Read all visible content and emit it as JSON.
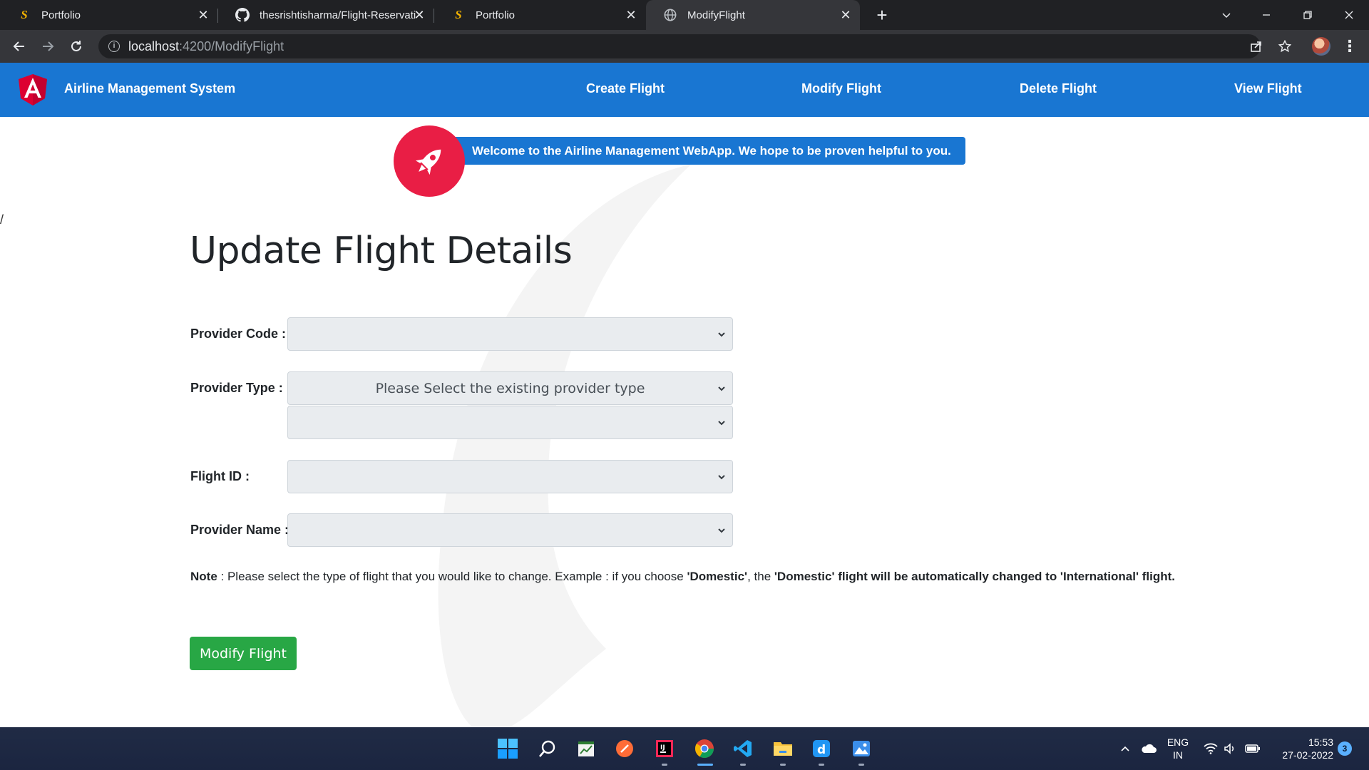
{
  "browser": {
    "tabs": [
      {
        "title": "Portfolio",
        "icon": "portfolio-s-icon"
      },
      {
        "title": "thesrishtisharma/Flight-Reservati",
        "icon": "github-icon"
      },
      {
        "title": "Portfolio",
        "icon": "portfolio-s-icon"
      },
      {
        "title": "ModifyFlight",
        "icon": "globe-icon"
      }
    ],
    "active_tab_index": 3,
    "url_host": "localhost",
    "url_path": ":4200/ModifyFlight"
  },
  "navbar": {
    "brand": "Airline Management System",
    "links": [
      "Create Flight",
      "Modify Flight",
      "Delete Flight",
      "View Flight"
    ]
  },
  "welcome": {
    "message": "Welcome to the Airline Management WebApp. We hope to be proven helpful to you."
  },
  "stray_text": "/",
  "form": {
    "title": "Update Flight Details",
    "provider_code_label": "Provider Code :",
    "provider_code_value": "",
    "provider_type_label": "Provider Type :",
    "provider_type_placeholder": "Please Select the existing provider type",
    "provider_type_secondary_value": "",
    "flight_id_label": "Flight ID :",
    "flight_id_value": "",
    "provider_name_label": "Provider Name :",
    "provider_name_value": "",
    "note_label": "Note",
    "note_text_1": " : Please select the type of flight that you would like to change. Example : if you choose ",
    "note_bold_1": "'Domestic'",
    "note_text_2": ", the ",
    "note_bold_2": "'Domestic' flight will be automatically changed to 'International' flight.",
    "submit_label": "Modify Flight"
  },
  "taskbar": {
    "language_line1": "ENG",
    "language_line2": "IN",
    "time": "15:53",
    "date": "27-02-2022",
    "notification_count": "3"
  },
  "colors": {
    "navbar": "#1976d2",
    "rocket_badge": "#e91e45",
    "button": "#28a745",
    "select_bg": "#e9ecef"
  }
}
